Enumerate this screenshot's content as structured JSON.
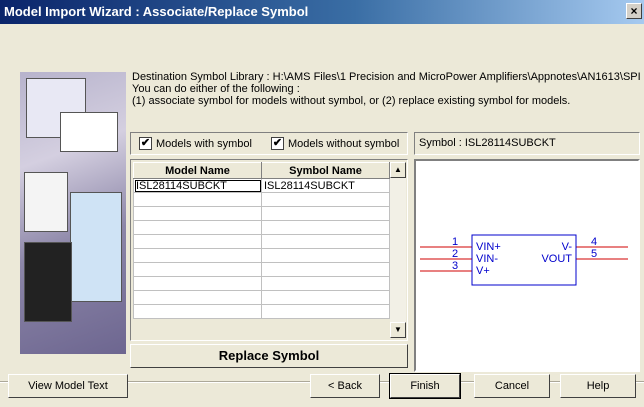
{
  "window": {
    "title": "Model Import Wizard : Associate/Replace Symbol",
    "close_glyph": "×"
  },
  "info": {
    "destination_label": "Destination Symbol Library :",
    "destination_path": "H:\\AMS Files\\1 Precision and MicroPower Amplifiers\\Appnotes\\AN1613\\SPI",
    "line2": "You can do either of the following :",
    "line3": "(1) associate symbol for models without symbol, or (2) replace existing symbol for models."
  },
  "checkboxes": {
    "models_with_symbol": {
      "label": "Models with symbol",
      "checked": true
    },
    "models_without_symbol": {
      "label": "Models without symbol",
      "checked": true
    }
  },
  "table": {
    "columns": [
      "Model Name",
      "Symbol Name"
    ],
    "rows": [
      [
        "ISL28114SUBCKT",
        "ISL28114SUBCKT"
      ]
    ],
    "empty_rows": 10
  },
  "replace_button": "Replace Symbol",
  "symbol": {
    "label": "Symbol : ISL28114SUBCKT",
    "pin_numbers": [
      "1",
      "2",
      "3",
      "4",
      "5"
    ],
    "left_pins": [
      "VIN+",
      "VIN-",
      "V+"
    ],
    "right_pins": [
      "V-",
      "VOUT"
    ],
    "colors": {
      "wire": "#d00000",
      "body": "#0000cc"
    }
  },
  "footer": {
    "view_model_text": "View Model Text",
    "back": "< Back",
    "finish": "Finish",
    "cancel": "Cancel",
    "help": "Help"
  },
  "icons": {
    "scroll_up": "▲",
    "scroll_down": "▼",
    "check": "✔"
  }
}
